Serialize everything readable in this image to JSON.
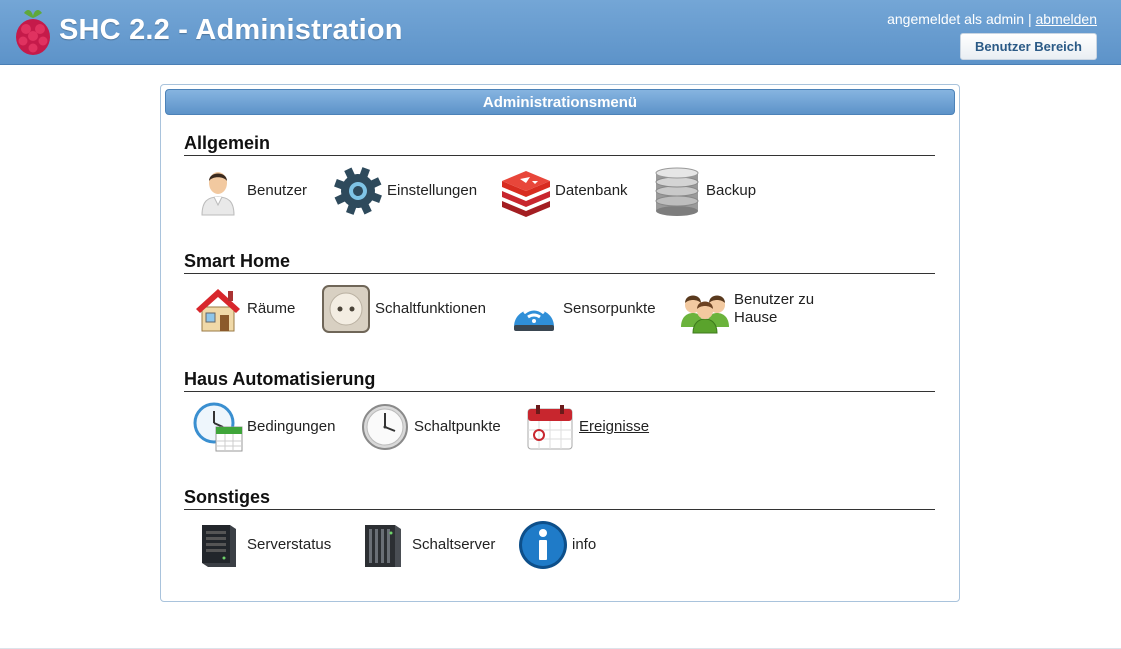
{
  "header": {
    "title": "SHC 2.2 - Administration",
    "logged_in_text": "angemeldet als admin |",
    "logout_label": "abmelden",
    "user_area_label": "Benutzer Bereich"
  },
  "panel": {
    "title": "Administrationsmenü"
  },
  "sections": [
    {
      "title": "Allgemein",
      "items": [
        {
          "label": "Benutzer",
          "icon": "user-icon"
        },
        {
          "label": "Einstellungen",
          "icon": "gear-icon"
        },
        {
          "label": "Datenbank",
          "icon": "redis-icon"
        },
        {
          "label": "Backup",
          "icon": "database-icon"
        }
      ]
    },
    {
      "title": "Smart Home",
      "items": [
        {
          "label": "Räume",
          "icon": "house-icon"
        },
        {
          "label": "Schaltfunktionen",
          "icon": "socket-icon"
        },
        {
          "label": "Sensorpunkte",
          "icon": "sensor-icon"
        },
        {
          "label": "Benutzer zu Hause",
          "icon": "users-group-icon"
        }
      ]
    },
    {
      "title": "Haus Automatisierung",
      "items": [
        {
          "label": "Bedingungen",
          "icon": "clock-calendar-icon"
        },
        {
          "label": "Schaltpunkte",
          "icon": "clock-icon"
        },
        {
          "label": "Ereignisse",
          "icon": "calendar-icon"
        }
      ]
    },
    {
      "title": "Sonstiges",
      "items": [
        {
          "label": "Serverstatus",
          "icon": "server-icon"
        },
        {
          "label": "Schaltserver",
          "icon": "server-rack-icon"
        },
        {
          "label": "info",
          "icon": "info-icon"
        }
      ]
    }
  ],
  "colors": {
    "header": "#5d93c9",
    "panel_border": "#a9c3dc",
    "accent_red": "#c8262e"
  }
}
